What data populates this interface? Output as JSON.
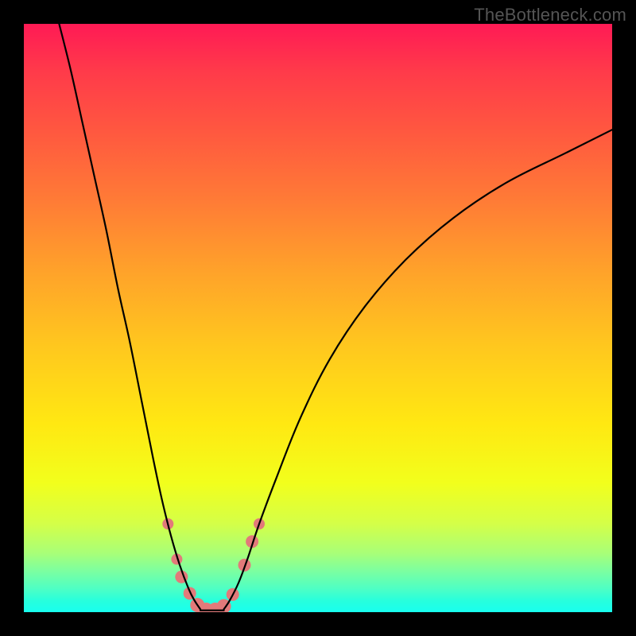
{
  "watermark": "TheBottleneck.com",
  "chart_data": {
    "type": "line",
    "title": "",
    "xlabel": "",
    "ylabel": "",
    "xlim": [
      0,
      100
    ],
    "ylim": [
      0,
      100
    ],
    "series": [
      {
        "name": "left-branch",
        "x": [
          6,
          8,
          10,
          12,
          14,
          16,
          18,
          20,
          22,
          23.5,
          25,
          26.5,
          28,
          29,
          30
        ],
        "y": [
          100,
          92,
          83,
          74,
          65,
          55,
          46,
          36,
          26,
          19,
          13,
          8,
          4,
          2,
          0.5
        ]
      },
      {
        "name": "right-branch",
        "x": [
          34,
          35,
          36.5,
          38,
          40,
          43,
          47,
          52,
          58,
          65,
          73,
          82,
          92,
          100
        ],
        "y": [
          0.5,
          2,
          5,
          9,
          15,
          23,
          33,
          43,
          52,
          60,
          67,
          73,
          78,
          82
        ]
      }
    ],
    "bottom_segment": {
      "x": [
        30,
        34
      ],
      "y": [
        0.3,
        0.3
      ]
    },
    "markers": {
      "name": "highlighted-points",
      "color": "#e27a7a",
      "points": [
        {
          "x": 24.5,
          "y": 15,
          "r": 7
        },
        {
          "x": 26.0,
          "y": 9,
          "r": 7
        },
        {
          "x": 26.8,
          "y": 6,
          "r": 8
        },
        {
          "x": 28.2,
          "y": 3.2,
          "r": 8
        },
        {
          "x": 29.5,
          "y": 1.2,
          "r": 9
        },
        {
          "x": 31.0,
          "y": 0.4,
          "r": 9
        },
        {
          "x": 32.5,
          "y": 0.4,
          "r": 9
        },
        {
          "x": 34.0,
          "y": 1.0,
          "r": 9
        },
        {
          "x": 35.5,
          "y": 3.0,
          "r": 8
        },
        {
          "x": 37.5,
          "y": 8.0,
          "r": 8
        },
        {
          "x": 38.8,
          "y": 12.0,
          "r": 8
        },
        {
          "x": 40.0,
          "y": 15.0,
          "r": 7
        }
      ]
    }
  }
}
